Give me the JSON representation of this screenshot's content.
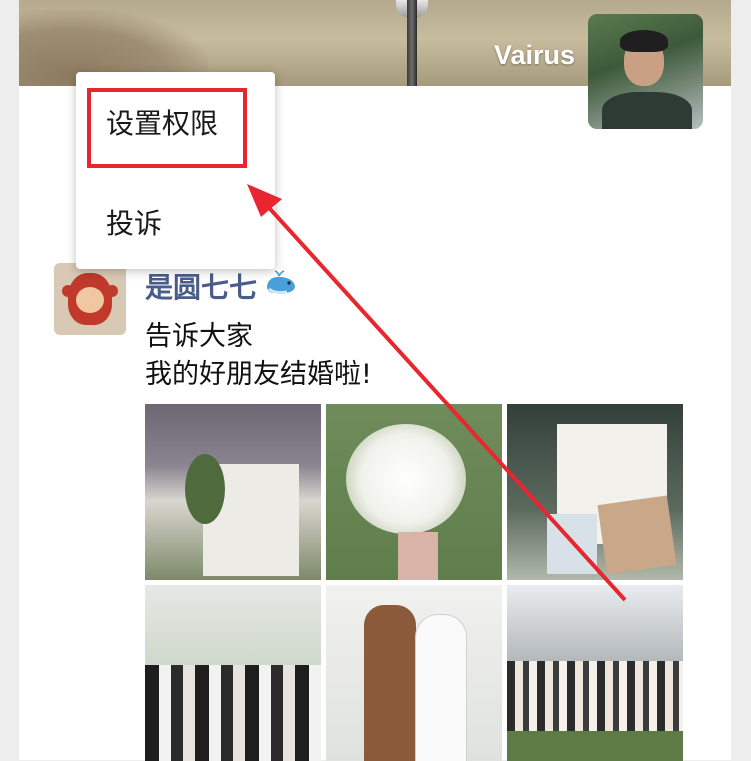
{
  "cover": {
    "username": "Vairus"
  },
  "menu": {
    "items": [
      {
        "label": "设置权限"
      },
      {
        "label": "投诉"
      }
    ]
  },
  "post": {
    "author": "是圆七七",
    "lines": [
      "告诉大家",
      "我的好朋友结婚啦!"
    ],
    "photos": [
      {
        "subject": "wedding-backdrop"
      },
      {
        "subject": "bridal-bouquet"
      },
      {
        "subject": "wedding-sign"
      },
      {
        "subject": "group-photo"
      },
      {
        "subject": "couple-ceremony"
      },
      {
        "subject": "crowd-photo"
      }
    ]
  },
  "colors": {
    "highlight": "#e8262f",
    "author_name": "#4a5d8a",
    "page_background": "#ededed"
  }
}
